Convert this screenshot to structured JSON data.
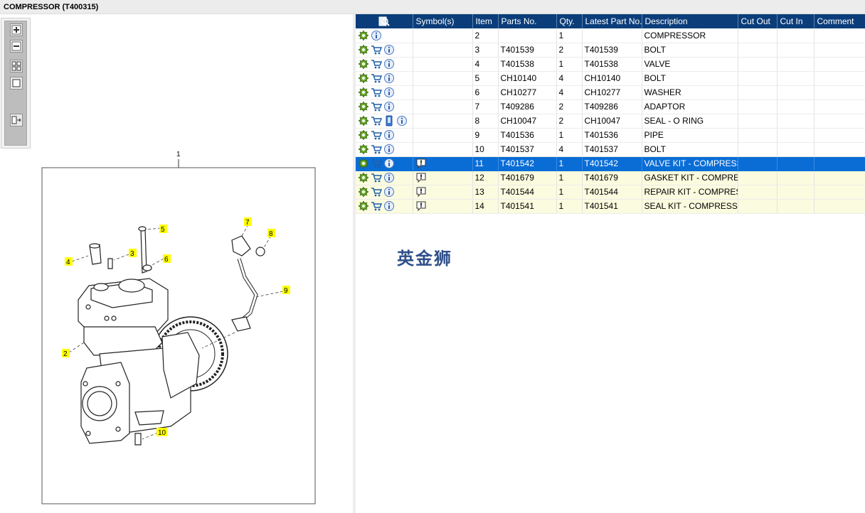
{
  "window": {
    "title": "COMPRESSOR (T400315)"
  },
  "drawing": {
    "frame_label": "1",
    "callouts": [
      "2",
      "3",
      "4",
      "5",
      "6",
      "7",
      "8",
      "9",
      "10"
    ]
  },
  "table": {
    "headers": {
      "symbols": "Symbol(s)",
      "item": "Item",
      "parts_no": "Parts No.",
      "qty": "Qty.",
      "latest_part_no": "Latest Part No.",
      "description": "Description",
      "cut_out": "Cut Out",
      "cut_in": "Cut In",
      "comment": "Comment"
    },
    "rows": [
      {
        "item": "2",
        "parts_no": "",
        "qty": "1",
        "latest": "",
        "description": "COMPRESSOR",
        "cut_out": "",
        "cut_in": "",
        "comment": ""
      },
      {
        "item": "3",
        "parts_no": "T401539",
        "qty": "2",
        "latest": "T401539",
        "description": "BOLT",
        "cut_out": "",
        "cut_in": "",
        "comment": ""
      },
      {
        "item": "4",
        "parts_no": "T401538",
        "qty": "1",
        "latest": "T401538",
        "description": "VALVE",
        "cut_out": "",
        "cut_in": "",
        "comment": ""
      },
      {
        "item": "5",
        "parts_no": "CH10140",
        "qty": "4",
        "latest": "CH10140",
        "description": "BOLT",
        "cut_out": "",
        "cut_in": "",
        "comment": ""
      },
      {
        "item": "6",
        "parts_no": "CH10277",
        "qty": "4",
        "latest": "CH10277",
        "description": "WASHER",
        "cut_out": "",
        "cut_in": "",
        "comment": ""
      },
      {
        "item": "7",
        "parts_no": "T409286",
        "qty": "2",
        "latest": "T409286",
        "description": "ADAPTOR",
        "cut_out": "",
        "cut_in": "",
        "comment": ""
      },
      {
        "item": "8",
        "parts_no": "CH10047",
        "qty": "2",
        "latest": "CH10047",
        "description": "SEAL - O RING",
        "cut_out": "",
        "cut_in": "",
        "comment": ""
      },
      {
        "item": "9",
        "parts_no": "T401536",
        "qty": "1",
        "latest": "T401536",
        "description": "PIPE",
        "cut_out": "",
        "cut_in": "",
        "comment": ""
      },
      {
        "item": "10",
        "parts_no": "T401537",
        "qty": "4",
        "latest": "T401537",
        "description": "BOLT",
        "cut_out": "",
        "cut_in": "",
        "comment": ""
      },
      {
        "item": "11",
        "parts_no": "T401542",
        "qty": "1",
        "latest": "T401542",
        "description": "VALVE KIT - COMPRESSOR",
        "cut_out": "",
        "cut_in": "",
        "comment": ""
      },
      {
        "item": "12",
        "parts_no": "T401679",
        "qty": "1",
        "latest": "T401679",
        "description": "GASKET KIT - COMPRESSO",
        "cut_out": "",
        "cut_in": "",
        "comment": ""
      },
      {
        "item": "13",
        "parts_no": "T401544",
        "qty": "1",
        "latest": "T401544",
        "description": "REPAIR KIT - COMPRESSO",
        "cut_out": "",
        "cut_in": "",
        "comment": ""
      },
      {
        "item": "14",
        "parts_no": "T401541",
        "qty": "1",
        "latest": "T401541",
        "description": "SEAL KIT - COMPRESSOR",
        "cut_out": "",
        "cut_in": "",
        "comment": ""
      }
    ]
  },
  "watermark": "英金狮",
  "colors": {
    "header_bg": "#0b3d7a",
    "selected_row": "#0a6dd6",
    "note_row": "#fbfbdf",
    "callout_bg": "#ffff00"
  },
  "icons": [
    "zoom-in-icon",
    "zoom-out-icon",
    "fit-all-icon",
    "fit-page-icon",
    "toggle-list-icon",
    "search-icon",
    "gear-icon",
    "cart-icon",
    "info-icon",
    "document-icon",
    "note-icon"
  ]
}
